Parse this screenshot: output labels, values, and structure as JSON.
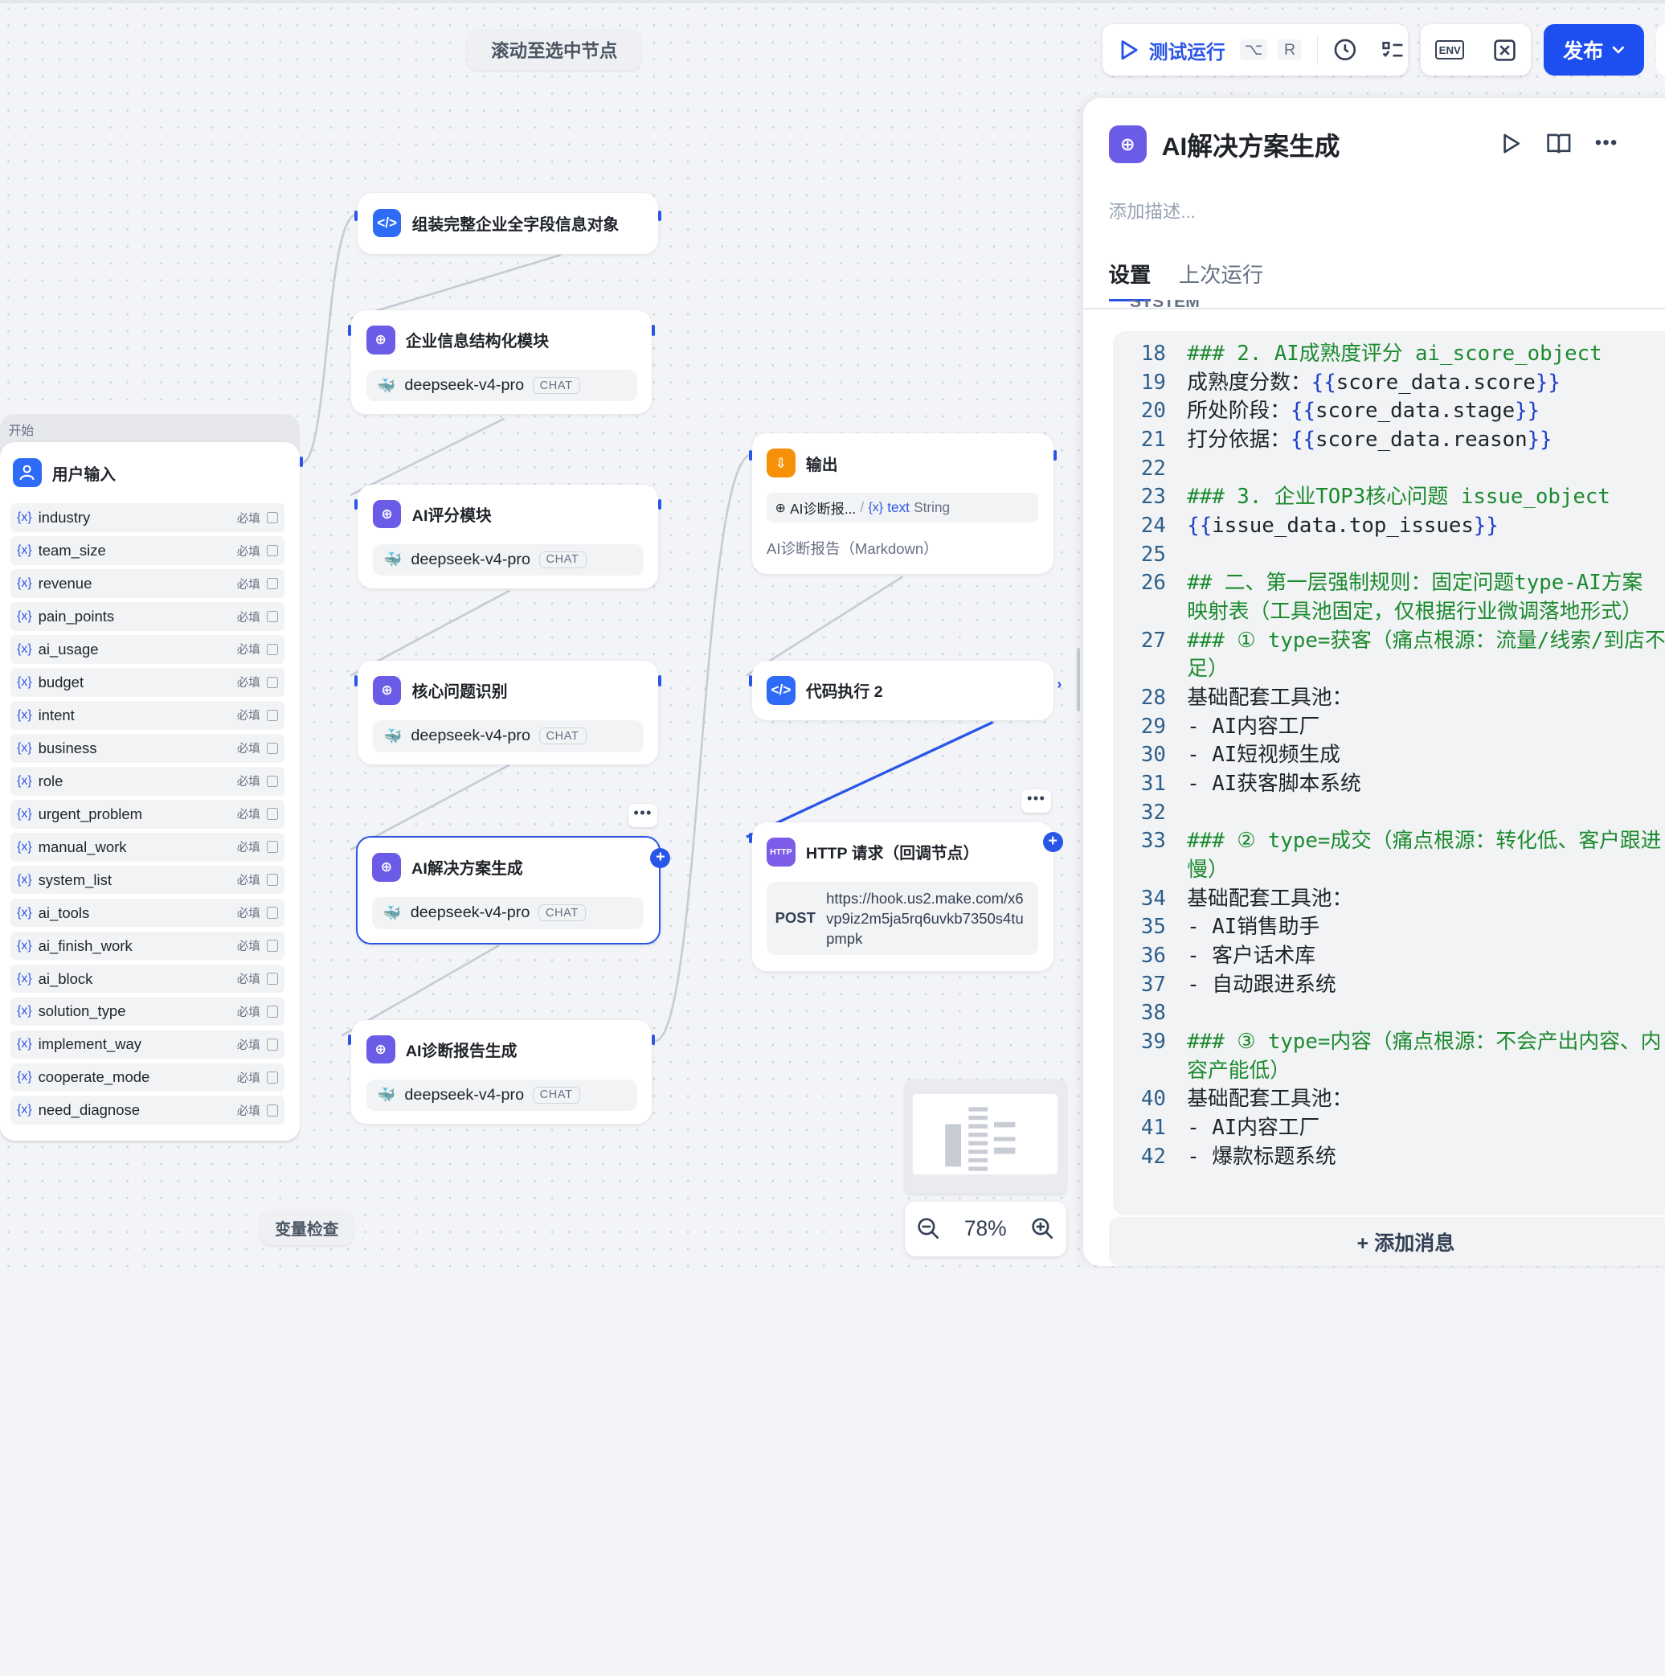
{
  "canvas": {
    "scroll_to_selected": "滚动至选中节点",
    "variable_inspect": "变量检查",
    "zoom_level": "78%"
  },
  "toolbar": {
    "test_run": "测试运行",
    "shortcut_alt": "⌥",
    "shortcut_key": "R",
    "env_label": "ENV",
    "publish": "发布"
  },
  "start_node": {
    "group_label": "开始",
    "title": "用户输入",
    "required_label": "必填",
    "variables": [
      "industry",
      "team_size",
      "revenue",
      "pain_points",
      "ai_usage",
      "budget",
      "intent",
      "business",
      "role",
      "urgent_problem",
      "manual_work",
      "system_list",
      "ai_tools",
      "ai_finish_work",
      "ai_block",
      "solution_type",
      "implement_way",
      "cooperate_mode",
      "need_diagnose"
    ]
  },
  "nodes": {
    "assemble": {
      "title": "组装完整企业全字段信息对象"
    },
    "struct": {
      "title": "企业信息结构化模块",
      "model": "deepseek-v4-pro",
      "tag": "CHAT"
    },
    "score": {
      "title": "AI评分模块",
      "model": "deepseek-v4-pro",
      "tag": "CHAT"
    },
    "core": {
      "title": "核心问题识别",
      "model": "deepseek-v4-pro",
      "tag": "CHAT"
    },
    "solution": {
      "title": "AI解决方案生成",
      "model": "deepseek-v4-pro",
      "tag": "CHAT"
    },
    "report": {
      "title": "AI诊断报告生成",
      "model": "deepseek-v4-pro",
      "tag": "CHAT"
    },
    "output": {
      "title": "输出",
      "var_source": "AI诊断报...",
      "var_name": "text",
      "var_type": "String",
      "desc": "AI诊断报告（Markdown）"
    },
    "code2": {
      "title": "代码执行 2"
    },
    "http": {
      "title": "HTTP 请求（回调节点）",
      "method": "POST",
      "url": "https://hook.us2.make.com/x6vp9iz2m5ja5rq6uvkb7350s4tupmpk",
      "icon_text": "HTTP"
    }
  },
  "panel": {
    "title": "AI解决方案生成",
    "desc_placeholder": "添加描述...",
    "tabs": [
      "设置",
      "上次运行"
    ],
    "partial_header": "SYSTEM",
    "add_message": "+ 添加消息",
    "code_lines": [
      {
        "n": "18",
        "parts": [
          {
            "t": "### 2. AI成熟度评分 ai_score_object",
            "c": "green"
          }
        ]
      },
      {
        "n": "19",
        "parts": [
          {
            "t": "成熟度分数：",
            "c": ""
          },
          {
            "t": "{{",
            "c": "bl"
          },
          {
            "t": "score_data.score",
            "c": ""
          },
          {
            "t": "}}",
            "c": "bl"
          }
        ]
      },
      {
        "n": "20",
        "parts": [
          {
            "t": "所处阶段：",
            "c": ""
          },
          {
            "t": "{{",
            "c": "bl"
          },
          {
            "t": "score_data.stage",
            "c": ""
          },
          {
            "t": "}}",
            "c": "bl"
          }
        ]
      },
      {
        "n": "21",
        "parts": [
          {
            "t": "打分依据：",
            "c": ""
          },
          {
            "t": "{{",
            "c": "bl"
          },
          {
            "t": "score_data.reason",
            "c": ""
          },
          {
            "t": "}}",
            "c": "bl"
          }
        ]
      },
      {
        "n": "22",
        "parts": []
      },
      {
        "n": "23",
        "parts": [
          {
            "t": "### 3. 企业TOP3核心问题 issue_object",
            "c": "green"
          }
        ]
      },
      {
        "n": "24",
        "parts": [
          {
            "t": "{{",
            "c": "bl"
          },
          {
            "t": "issue_data.top_issues",
            "c": ""
          },
          {
            "t": "}}",
            "c": "bl"
          }
        ]
      },
      {
        "n": "25",
        "parts": []
      },
      {
        "n": "26",
        "parts": [
          {
            "t": "## 二、第一层强制规则：固定问题type-AI方案\n映射表（工具池固定，仅根据行业微调落地形式）",
            "c": "green"
          }
        ]
      },
      {
        "n": "27",
        "parts": [
          {
            "t": "### ① type=获客（痛点根源：流量/线索/到店不\n足）",
            "c": "green"
          }
        ]
      },
      {
        "n": "28",
        "parts": [
          {
            "t": "基础配套工具池：",
            "c": ""
          }
        ]
      },
      {
        "n": "29",
        "parts": [
          {
            "t": "- AI内容工厂",
            "c": ""
          }
        ]
      },
      {
        "n": "30",
        "parts": [
          {
            "t": "- AI短视频生成",
            "c": ""
          }
        ]
      },
      {
        "n": "31",
        "parts": [
          {
            "t": "- AI获客脚本系统",
            "c": ""
          }
        ]
      },
      {
        "n": "32",
        "parts": []
      },
      {
        "n": "33",
        "parts": [
          {
            "t": "### ② type=成交（痛点根源：转化低、客户跟进\n慢）",
            "c": "green"
          }
        ]
      },
      {
        "n": "34",
        "parts": [
          {
            "t": "基础配套工具池：",
            "c": ""
          }
        ]
      },
      {
        "n": "35",
        "parts": [
          {
            "t": "- AI销售助手",
            "c": ""
          }
        ]
      },
      {
        "n": "36",
        "parts": [
          {
            "t": "- 客户话术库",
            "c": ""
          }
        ]
      },
      {
        "n": "37",
        "parts": [
          {
            "t": "- 自动跟进系统",
            "c": ""
          }
        ]
      },
      {
        "n": "38",
        "parts": []
      },
      {
        "n": "39",
        "parts": [
          {
            "t": "### ③ type=内容（痛点根源：不会产出内容、内\n容产能低）",
            "c": "green"
          }
        ]
      },
      {
        "n": "40",
        "parts": [
          {
            "t": "基础配套工具池：",
            "c": ""
          }
        ]
      },
      {
        "n": "41",
        "parts": [
          {
            "t": "- AI内容工厂",
            "c": ""
          }
        ]
      },
      {
        "n": "42",
        "parts": [
          {
            "t": "- 爆款标题系统",
            "c": ""
          }
        ]
      }
    ]
  }
}
